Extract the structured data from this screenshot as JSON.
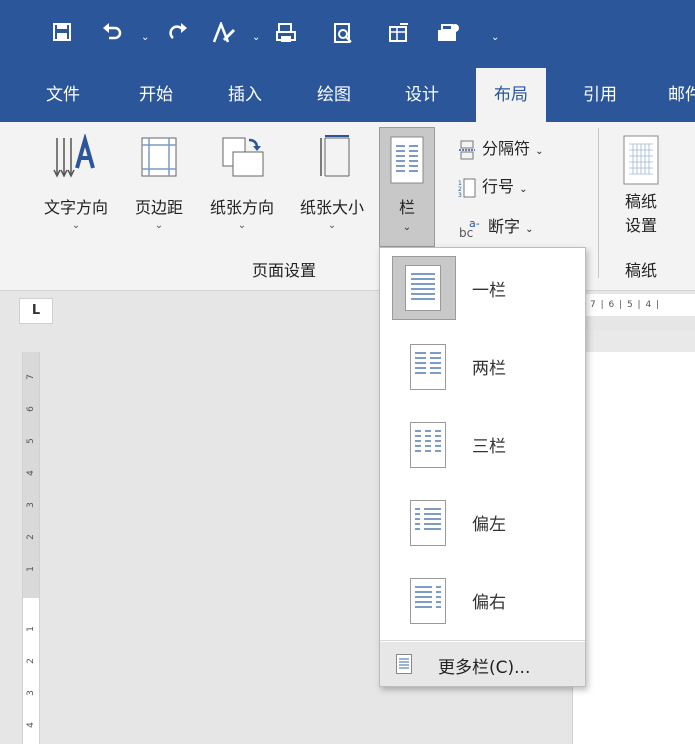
{
  "quick_access": {
    "icons": [
      "save-icon",
      "undo-icon",
      "redo-icon",
      "format-painter-icon",
      "print-preview-icon",
      "find-icon",
      "table-icon",
      "toolbar-options-icon",
      "customize-icon"
    ]
  },
  "tabs": [
    "文件",
    "开始",
    "插入",
    "绘图",
    "设计",
    "布局",
    "引用",
    "邮件"
  ],
  "active_tab": "布局",
  "ribbon": {
    "text_direction": "文字方向",
    "margins": "页边距",
    "orientation": "纸张方向",
    "size": "纸张大小",
    "columns": "栏",
    "breaks": "分隔符",
    "line_numbers": "行号",
    "hyphenation": "断字",
    "manuscript_settings_line1": "稿纸",
    "manuscript_settings_line2": "设置",
    "group_page_setup": "页面设置",
    "group_manuscript": "稿纸",
    "dropdown_chevron": "⌄"
  },
  "ruler": {
    "horizontal_marks": "7 | 6 | 5 | 4 |",
    "vertical_marks": [
      "7",
      "6",
      "5",
      "4",
      "3",
      "2",
      "1",
      "1",
      "2",
      "3",
      "4"
    ]
  },
  "columns_menu": {
    "items": [
      {
        "label": "一栏",
        "selected": true
      },
      {
        "label": "两栏",
        "selected": false
      },
      {
        "label": "三栏",
        "selected": false
      },
      {
        "label": "偏左",
        "selected": false
      },
      {
        "label": "偏右",
        "selected": false
      }
    ],
    "more": "更多栏(C)..."
  },
  "colors": {
    "ribbon_blue": "#2b579a",
    "ribbon_bg": "#f3f3f3",
    "selected_bg": "#c8c8c8",
    "line_blue": "#7a9cc6"
  }
}
